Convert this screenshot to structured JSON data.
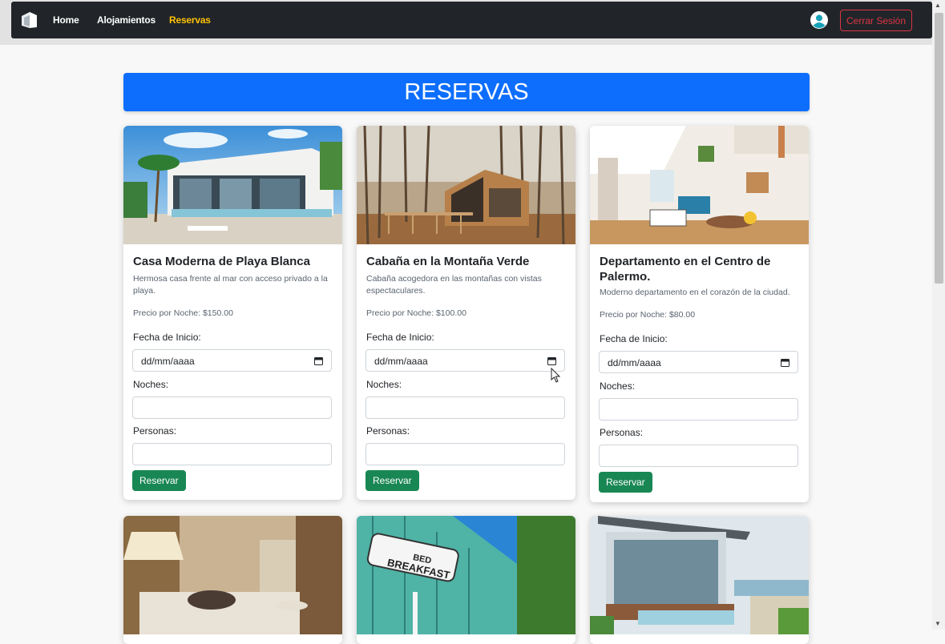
{
  "nav": {
    "links": [
      "Home",
      "Alojamientos",
      "Reservas"
    ],
    "active": "Reservas",
    "logout_label": "Cerrar Sesión"
  },
  "page": {
    "title": "RESERVAS"
  },
  "form_labels": {
    "start_date": "Fecha de Inicio:",
    "nights": "Noches:",
    "people": "Personas:",
    "date_placeholder": "dd/mm/aaaa",
    "reserve_button": "Reservar"
  },
  "cards": [
    {
      "title": "Casa Moderna de Playa Blanca",
      "description": "Hermosa casa frente al mar con acceso privado a la playa.",
      "price": "Precio por Noche: $150.00"
    },
    {
      "title": "Cabaña en la Montaña Verde",
      "description": "Cabaña acogedora en las montañas con vistas espectaculares.",
      "price": "Precio por Noche: $100.00"
    },
    {
      "title": "Departamento en el Centro de Palermo.",
      "description": "Moderno departamento en el corazón de la ciudad.",
      "price": "Precio por Noche: $80.00"
    }
  ],
  "colors": {
    "navbar": "#212529",
    "active_link": "#ffc107",
    "banner": "#0d6efd",
    "reserve_button": "#198754",
    "logout": "#dc3545"
  }
}
